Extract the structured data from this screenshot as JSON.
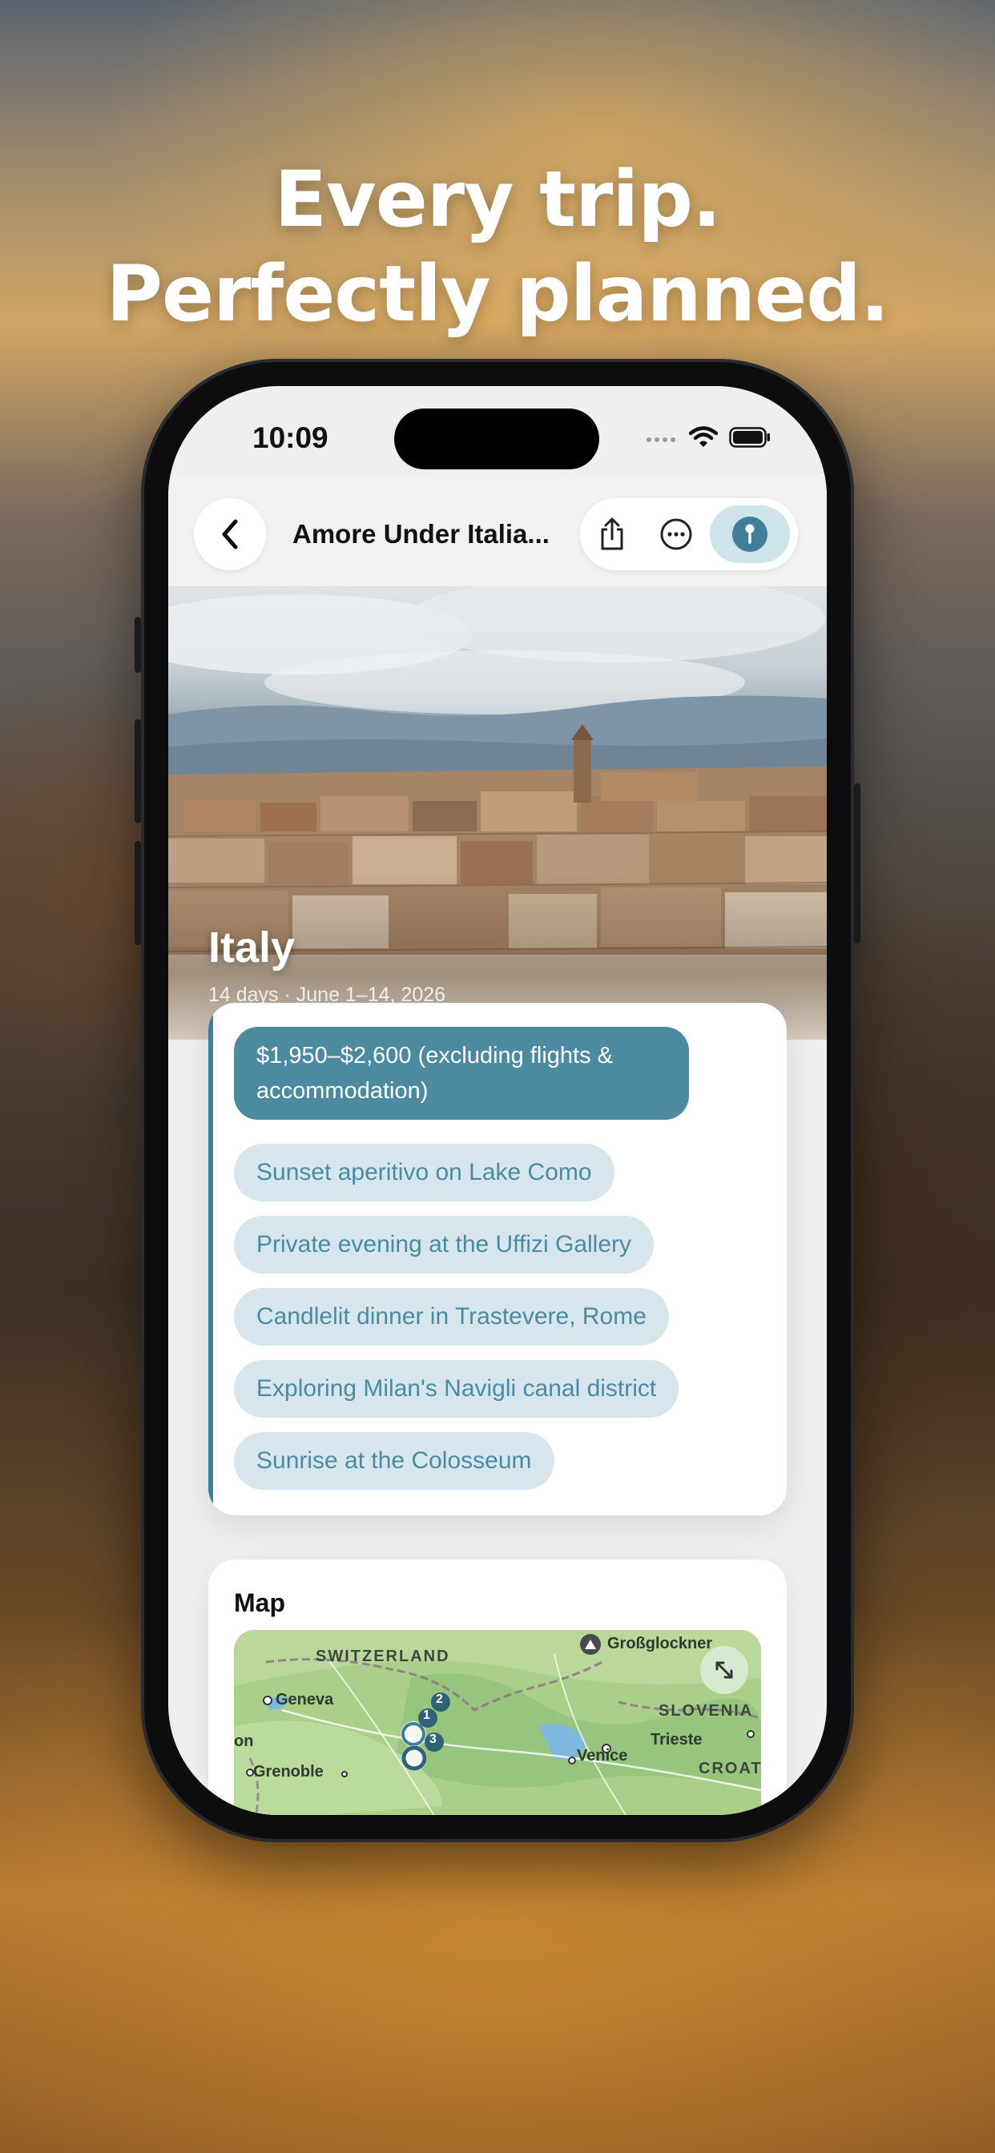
{
  "headline": {
    "line1": "Every trip.",
    "line2": "Perfectly planned."
  },
  "status_bar": {
    "time": "10:09"
  },
  "nav": {
    "title": "Amore Under Italia...",
    "back_icon": "chevron-left-icon",
    "share_icon": "share-icon",
    "more_icon": "ellipsis-circle-icon",
    "pin_icon": "map-pin-icon"
  },
  "trip": {
    "title": "Italy",
    "subtitle": "14 days · June 1–14, 2026"
  },
  "highlights": {
    "budget": "$1,950–$2,600 (excluding flights & accommodation)",
    "items": [
      "Sunset aperitivo on Lake Como",
      "Private evening at the Uffizi Gallery",
      "Candlelit dinner in Trastevere, Rome",
      "Exploring Milan's Navigli canal district",
      "Sunrise at the Colosseum"
    ]
  },
  "map": {
    "heading": "Map",
    "labels": {
      "switzerland": "SWITZERLAND",
      "geneva": "Geneva",
      "grossglockner": "Großglockner",
      "slovenia": "SLOVENIA",
      "trieste": "Trieste",
      "venice": "Venice",
      "grenoble": "Grenoble",
      "croat": "CROAT",
      "on": "on"
    },
    "markers": [
      "1",
      "2",
      "3"
    ],
    "expand_icon": "expand-arrows-icon"
  },
  "colors": {
    "accent": "#4c8aa0",
    "chip_bg": "#d7e6ec",
    "chip_text": "#4a8ba3"
  }
}
